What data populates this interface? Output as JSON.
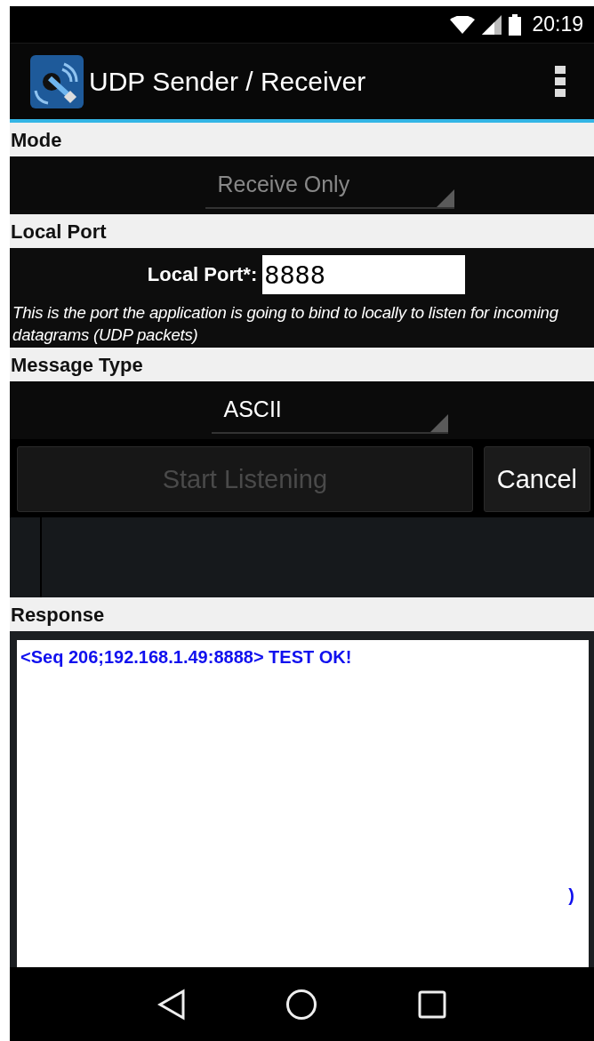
{
  "status_bar": {
    "time": "20:19"
  },
  "app_bar": {
    "title": "UDP Sender / Receiver"
  },
  "sections": [
    {
      "kind": "spinner",
      "header": "Mode",
      "value": "Receive Only",
      "disabled": true
    },
    {
      "kind": "port",
      "header": "Local Port",
      "label": "Local Port*:",
      "value": "8888",
      "hint": "This is the port the application is going to bind to locally to listen for incoming datagrams (UDP packets)"
    },
    {
      "kind": "spinner",
      "header": "Message Type",
      "value": "ASCII",
      "disabled": false
    }
  ],
  "buttons": [
    {
      "label": "Start Listening",
      "disabled": true
    },
    {
      "label": "Cancel",
      "disabled": false
    }
  ],
  "response": {
    "header": "Response",
    "lines": [
      "<Seq 206;192.168.1.49:8888> TEST OK!"
    ],
    "trailing": ")"
  }
}
